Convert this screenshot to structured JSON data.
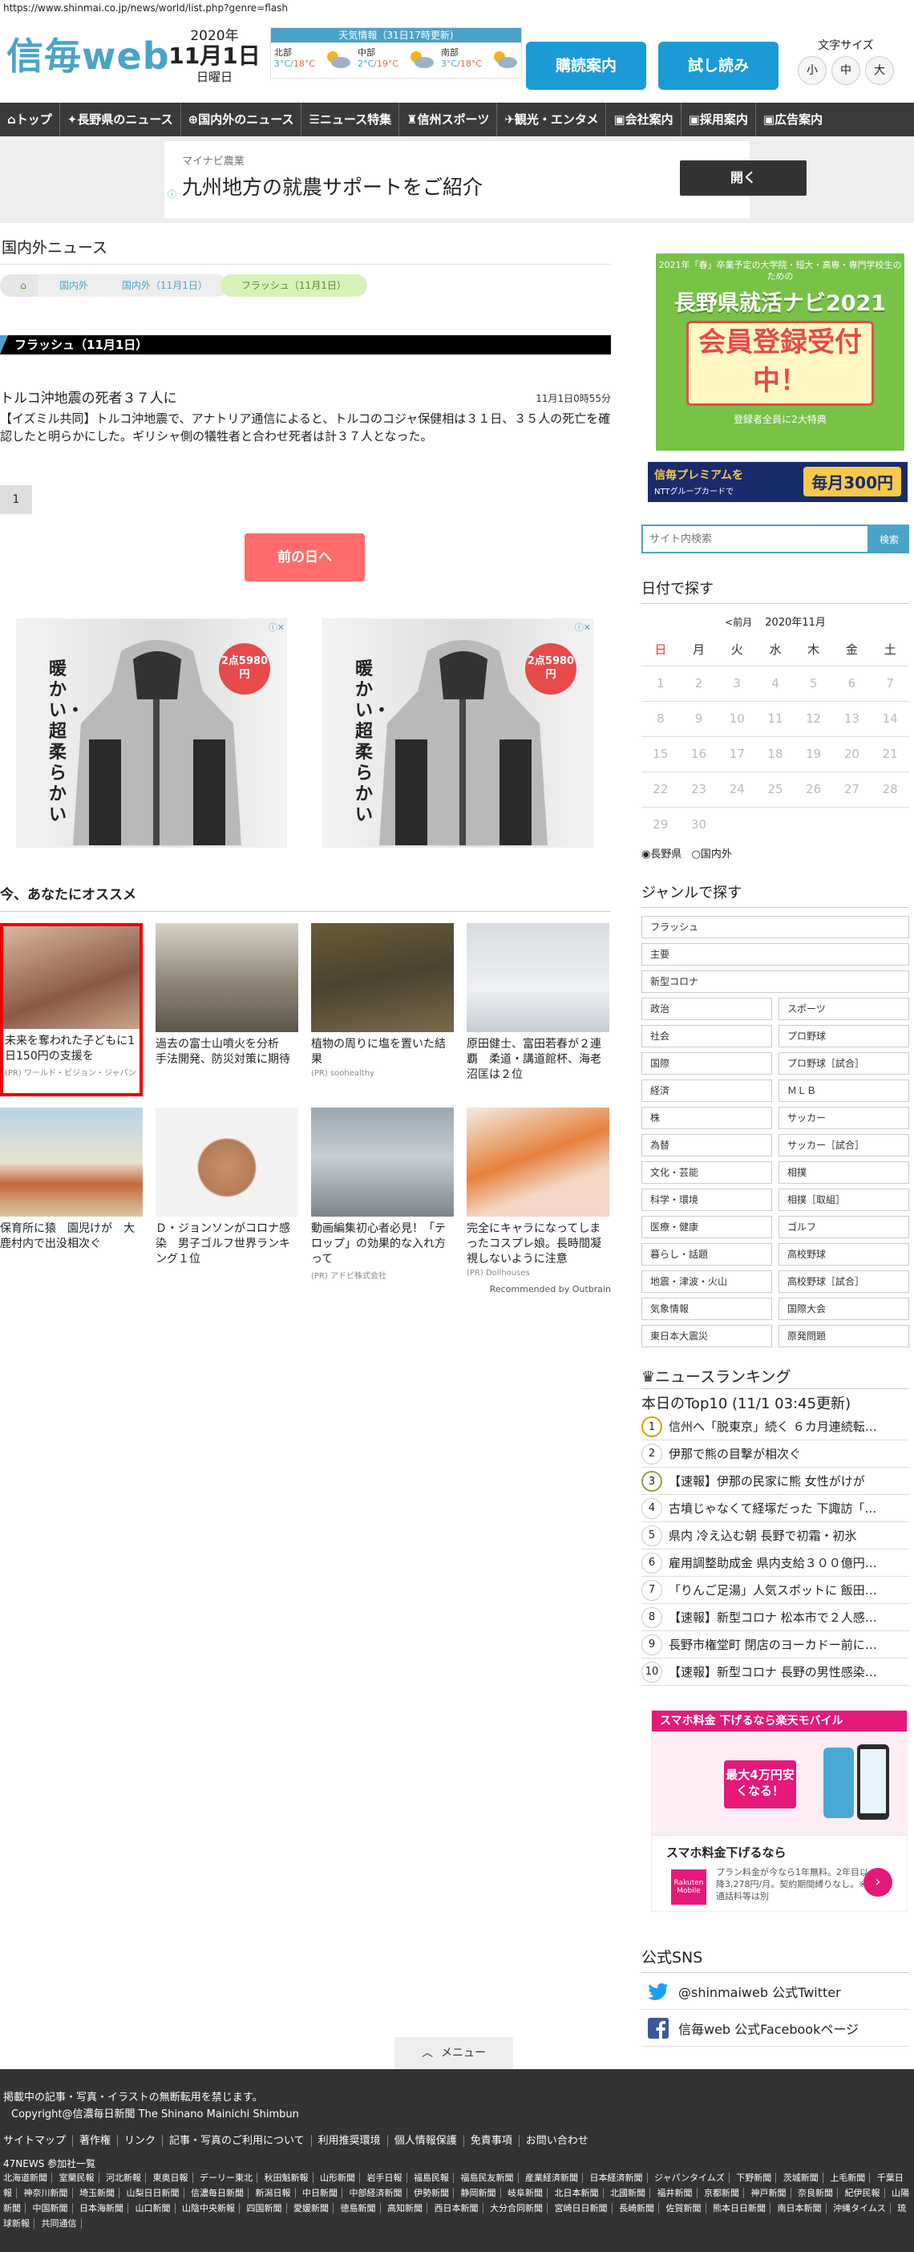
{
  "url": "https://www.shinmai.co.jp/news/world/list.php?genre=flash",
  "logo": {
    "name": "信毎web"
  },
  "date": {
    "year": "2020年",
    "md": "11月1日",
    "weekday": "日曜日"
  },
  "weather": {
    "title": "天気情報（31日17時更新)",
    "regions": [
      {
        "name": "北部",
        "temp": "3°C/",
        "temp_hi": "18°C"
      },
      {
        "name": "中部",
        "temp": "2°C/",
        "temp_hi": "19°C"
      },
      {
        "name": "南部",
        "temp": "3°C/",
        "temp_hi": "18°C"
      }
    ]
  },
  "header_buttons": {
    "subscribe": "購読案内",
    "trial": "試し読み"
  },
  "font_size": {
    "label": "文字サイズ",
    "small": "小",
    "medium": "中",
    "large": "大"
  },
  "nav": [
    "トップ",
    "長野県のニュース",
    "国内外のニュース",
    "ニュース特集",
    "信州スポーツ",
    "観光・エンタメ",
    "会社案内",
    "採用案内",
    "広告案内"
  ],
  "ad_band": {
    "sub": "マイナビ農業",
    "title": "九州地方の就農サポートをご紹介",
    "button": "開く"
  },
  "section_title": "国内外ニュース",
  "breadcrumb": [
    "国内外",
    "国内外（11月1日）",
    "フラッシュ（11月1日）"
  ],
  "category_bar": "フラッシュ（11月1日）",
  "article": {
    "headline": "トルコ沖地震の死者３７人に",
    "time": "11月1日0時55分",
    "body": "【イズミル共同】トルコ沖地震で、アナトリア通信によると、トルコのコジャ保健相は３１日、３５人の死亡を確認したと明らかにした。ギリシャ側の犠牲者と合わせ死者は計３７人となった。"
  },
  "pager": "1",
  "prev_button": "前の日へ",
  "jacket_ads": [
    {
      "caption": "暖かい・超柔らかい",
      "badge": "2点5980円"
    },
    {
      "caption": "暖かい・超柔らかい",
      "badge": "2点5980円"
    }
  ],
  "recommend": {
    "title": "今、あなたにオススメ",
    "items": [
      {
        "caption": "未来を奪われた子どもに1日150円の支援を",
        "source": "(PR) ワールド・ビジョン・ジャパン"
      },
      {
        "caption": "過去の富士山噴火を分析　手法開発、防災対策に期待",
        "source": ""
      },
      {
        "caption": "植物の周りに塩を置いた結果",
        "source": "(PR) soohealthy"
      },
      {
        "caption": "原田健士、富田若春が２連覇　柔道・講道館杯、海老沼匡は２位",
        "source": ""
      },
      {
        "caption": "保育所に猿　園児けが　大鹿村内で出没相次ぐ",
        "source": ""
      },
      {
        "caption": "Ｄ・ジョンソンがコロナ感染　男子ゴルフ世界ランキング１位",
        "source": ""
      },
      {
        "caption": "動画編集初心者必見！「テロップ」の効果的な入れ方って",
        "source": "(PR) アドビ株式会社"
      },
      {
        "caption": "完全にキャラになってしまったコスプレ娘。長時間凝視しないように注意",
        "source": "(PR) Dollhouses"
      }
    ],
    "footer": "Recommended by Outbrain"
  },
  "promo1": {
    "top": "2021年「春」卒業予定の大学院・短大・高専・専門学校生のための",
    "title": "長野県就活ナビ2021",
    "card": "会員登録受付中！",
    "bottom": "登録者全員に2大特典"
  },
  "promo2": {
    "a": "信毎プレミアムを",
    "b": "NTTグループカードで",
    "c": "毎月300円"
  },
  "search": {
    "placeholder": "サイト内検索",
    "button": "検索"
  },
  "calendar": {
    "title": "日付で探す",
    "prev": "<前月",
    "month": "2020年11月",
    "weekdays": [
      "日",
      "月",
      "火",
      "水",
      "木",
      "金",
      "土"
    ],
    "weeks": [
      [
        "1",
        "2",
        "3",
        "4",
        "5",
        "6",
        "7"
      ],
      [
        "8",
        "9",
        "10",
        "11",
        "12",
        "13",
        "14"
      ],
      [
        "15",
        "16",
        "17",
        "18",
        "19",
        "20",
        "21"
      ],
      [
        "22",
        "23",
        "24",
        "25",
        "26",
        "27",
        "28"
      ],
      [
        "29",
        "30",
        "",
        "",
        "",
        "",
        ""
      ]
    ],
    "radio1": "長野県",
    "radio2": "国内外"
  },
  "genre": {
    "title": "ジャンルで探す",
    "full": [
      "フラッシュ",
      "主要",
      "新型コロナ"
    ],
    "pairs": [
      [
        "政治",
        "スポーツ"
      ],
      [
        "社会",
        "プロ野球"
      ],
      [
        "国際",
        "プロ野球［試合］"
      ],
      [
        "経済",
        "ＭＬＢ"
      ],
      [
        "株",
        "サッカー"
      ],
      [
        "為替",
        "サッカー［試合］"
      ],
      [
        "文化・芸能",
        "相撲"
      ],
      [
        "科学・環境",
        "相撲［取組］"
      ],
      [
        "医療・健康",
        "ゴルフ"
      ],
      [
        "暮らし・話題",
        "高校野球"
      ],
      [
        "地震・津波・火山",
        "高校野球［試合］"
      ],
      [
        "気象情報",
        "国際大会"
      ],
      [
        "東日本大震災",
        "原発問題"
      ]
    ]
  },
  "ranking": {
    "title": "ニュースランキング",
    "subtitle": "本日のTop10 (11/1 03:45更新)",
    "items": [
      "信州へ「脱東京」続く ６カ月連続転…",
      "伊那で熊の目撃が相次ぐ",
      "【速報】伊那の民家に熊 女性がけが",
      "古墳じゃなくて経塚だった 下諏訪「…",
      "県内 冷え込む朝 長野で初霜・初氷",
      "雇用調整助成金 県内支給３００億円…",
      "「りんご足湯」人気スポットに 飯田…",
      "【速報】新型コロナ 松本市で２人感…",
      "長野市権堂町 閉店のヨーカドー前に…",
      "【速報】新型コロナ 長野の男性感染…"
    ]
  },
  "promo3": {
    "bar": "スマホ料金 下げるなら楽天モバイル",
    "amt": "最大4万円安くなる！"
  },
  "promo4": {
    "title": "スマホ料金下げるなら",
    "desc": "プラン料金が今なら1年無料。2年目以降3,278円/月。契約期間縛りなし。※通話料等は別",
    "logo": "Rakuten Mobile"
  },
  "sns": {
    "title": "公式SNS",
    "twitter": "@shinmaiweb 公式Twitter",
    "facebook": "信毎web 公式Facebookページ"
  },
  "menu_tab": "メニュー",
  "footer": {
    "copy1": "掲載中の記事・写真・イラストの無断転用を禁じます。",
    "copy2": "Copyright@信濃毎日新聞 The Shinano Mainichi Shimbun",
    "links": [
      "サイトマップ",
      "著作権",
      "リンク",
      "記事・写真のご利用について",
      "利用推奨環境",
      "個人情報保護",
      "免責事項",
      "お問い合わせ"
    ],
    "partners_title": "47NEWS 参加社一覧",
    "papers": [
      "北海道新聞",
      "室蘭民報",
      "河北新報",
      "東奥日報",
      "デーリー東北",
      "秋田魁新報",
      "山形新聞",
      "岩手日報",
      "福島民報",
      "福島民友新聞",
      "産業経済新聞",
      "日本経済新聞",
      "ジャパンタイムズ",
      "下野新聞",
      "茨城新聞",
      "上毛新聞",
      "千葉日報",
      "神奈川新聞",
      "埼玉新聞",
      "山梨日日新聞",
      "信濃毎日新聞",
      "新潟日報",
      "中日新聞",
      "中部経済新聞",
      "伊勢新聞",
      "静岡新聞",
      "岐阜新聞",
      "北日本新聞",
      "北國新聞",
      "福井新聞",
      "京都新聞",
      "神戸新聞",
      "奈良新聞",
      "紀伊民報",
      "山陽新聞",
      "中国新聞",
      "日本海新聞",
      "山口新聞",
      "山陰中央新報",
      "四国新聞",
      "愛媛新聞",
      "徳島新聞",
      "高知新聞",
      "西日本新聞",
      "大分合同新聞",
      "宮崎日日新聞",
      "長崎新聞",
      "佐賀新聞",
      "熊本日日新聞",
      "南日本新聞",
      "沖縄タイムス",
      "琉球新報",
      "共同通信"
    ]
  }
}
